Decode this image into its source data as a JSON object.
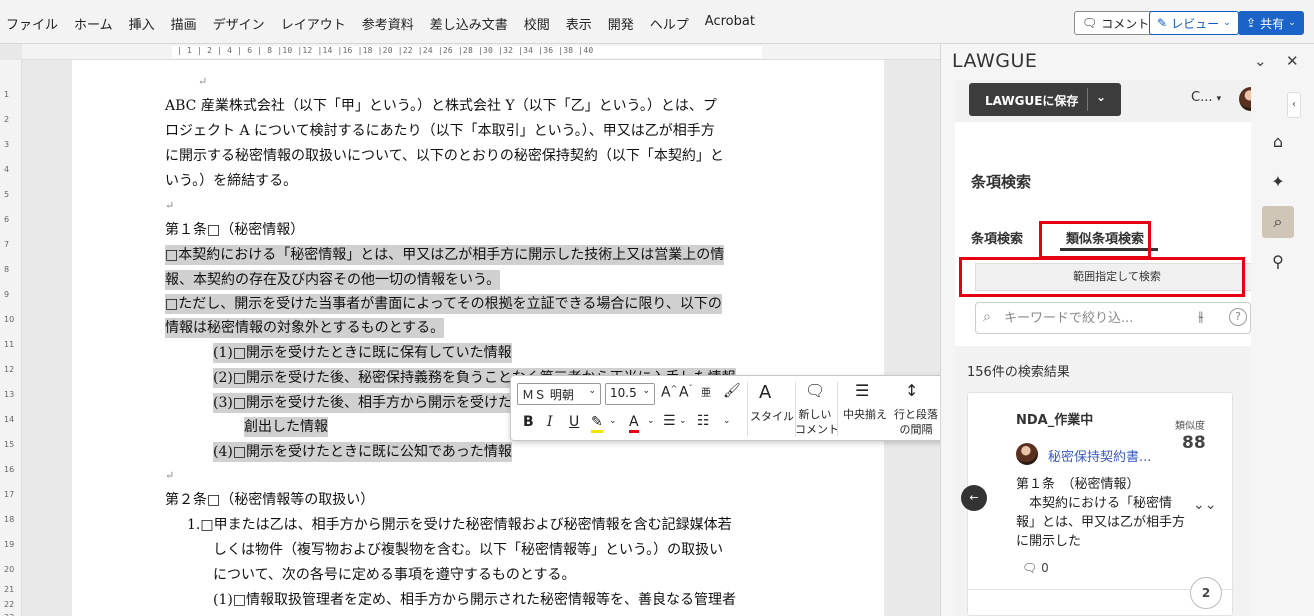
{
  "menu": {
    "items": [
      "ファイル",
      "ホーム",
      "挿入",
      "描画",
      "デザイン",
      "レイアウト",
      "参考資料",
      "差し込み文書",
      "校閲",
      "表示",
      "開発",
      "ヘルプ",
      "Acrobat"
    ],
    "comment_label": "コメント",
    "review_label": "レビュー",
    "share_label": "共有"
  },
  "ruler": {
    "ticks": "| 1 | 2 | 4 | 6 | 8 |10 |12 |14 |16 |18 |20 |22 |24 |26 |28 |30 |32 |34 |36 |38 |40",
    "vticks": [
      "1",
      "2",
      "3",
      "4",
      "5",
      "6",
      "7",
      "8",
      "9",
      "10",
      "11",
      "12",
      "13",
      "14",
      "15",
      "16",
      "17",
      "18",
      "19",
      "20",
      "21",
      "22",
      "23"
    ]
  },
  "document": {
    "lines": [
      "ABC 産業株式会社（以下「甲」という。）と株式会社 Y（以下「乙」という。）とは、プ",
      "ロジェクト A について検討するにあたり（以下「本取引」という。）、甲又は乙が相手方",
      "に開示する秘密情報の取扱いについて、以下のとおりの秘密保持契約（以下「本契約」と",
      "いう。）を締結する。",
      "第１条□（秘密情報）",
      "□本契約における「秘密情報」とは、甲又は乙が相手方に開示した技術上又は営業上の情",
      "報、本契約の存在及び内容その他一切の情報をいう。",
      "□ただし、開示を受けた当事者が書面によってその根拠を立証できる場合に限り、以下の",
      "情報は秘密情報の対象外とするものとする。",
      "(1)□開示を受けたときに既に保有していた情報",
      "(2)□開示を受けた後、秘密保持義務を負うことなく第三者から正当に入手した情報",
      "(3)□開示を受けた後、相手方から開示を受けた情報に関係なく独自に",
      "創出した情報",
      "(4)□開示を受けたときに既に公知であった情報",
      "第２条□（秘密情報等の取扱い）",
      "1.□甲または乙は、相手方から開示を受けた秘密情報および秘密情報を含む記録媒体若",
      "しくは物件（複写物および複製物を含む。以下「秘密情報等」という。）の取扱い",
      "について、次の各号に定める事項を遵守するものとする。",
      "(1)□情報取扱管理者を定め、相手方から開示された秘密情報等を、善良なる管理者"
    ],
    "para_mark": "↵"
  },
  "floatbar": {
    "font_name": "ＭＳ 明朝",
    "font_size": "10.5",
    "style_label": "スタイル",
    "new_comment_label_1": "新しい",
    "new_comment_label_2": "コメント",
    "center_label": "中央揃え",
    "spacing_label_1": "行と段落",
    "spacing_label_2": "の間隔",
    "paragraph_label": "段落"
  },
  "panel": {
    "title": "LAWGUE",
    "save_label": "LAWGUEに保存",
    "user_name": "C...",
    "section_title": "条項検索",
    "tab_search": "条項検索",
    "tab_similar": "類似条項検索",
    "range_search_label": "範囲指定して検索",
    "search_placeholder": "キーワードで絞り込...",
    "results_count": "156件の検索結果",
    "result": {
      "name": "NDA_作業中",
      "similarity_label": "類似度",
      "similarity_value": "88",
      "doc_title": "秘密保持契約書...",
      "snippet": "第１条　（秘密情報）\n　本契約における「秘密情報」とは、甲又は乙が相手方に開示した",
      "comments": "0",
      "page": "2"
    }
  },
  "colors": {
    "highlight_box": "#e60012",
    "share_button": "#1c63c8",
    "selection": "#d0d0d0"
  }
}
